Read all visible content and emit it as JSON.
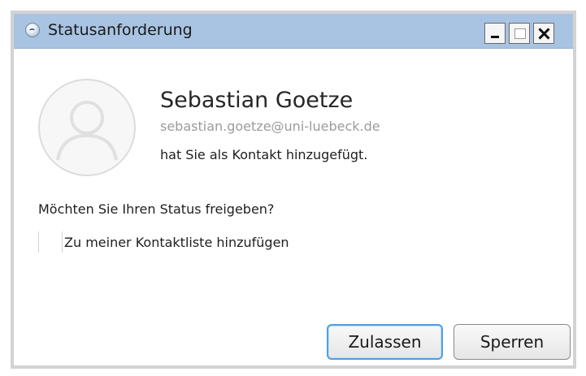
{
  "window": {
    "title": "Statusanforderung",
    "controls": {
      "minimize": "minimize-icon",
      "maximize": "maximize-icon",
      "close": "close-icon"
    }
  },
  "contact": {
    "avatar_icon": "person-placeholder-icon",
    "name": "Sebastian Goetze",
    "email": "sebastian.goetze@uni-luebeck.de",
    "message": "hat Sie als Kontakt hinzugefügt."
  },
  "prompt": {
    "question": "Möchten Sie Ihren Status freigeben?",
    "checkbox_label": "Zu meiner Kontaktliste hinzufügen",
    "checkbox_checked": false
  },
  "buttons": {
    "allow": "Zulassen",
    "block": "Sperren"
  },
  "colors": {
    "titlebar": "#a9c4e2",
    "focus_border": "#4f9fe3"
  }
}
